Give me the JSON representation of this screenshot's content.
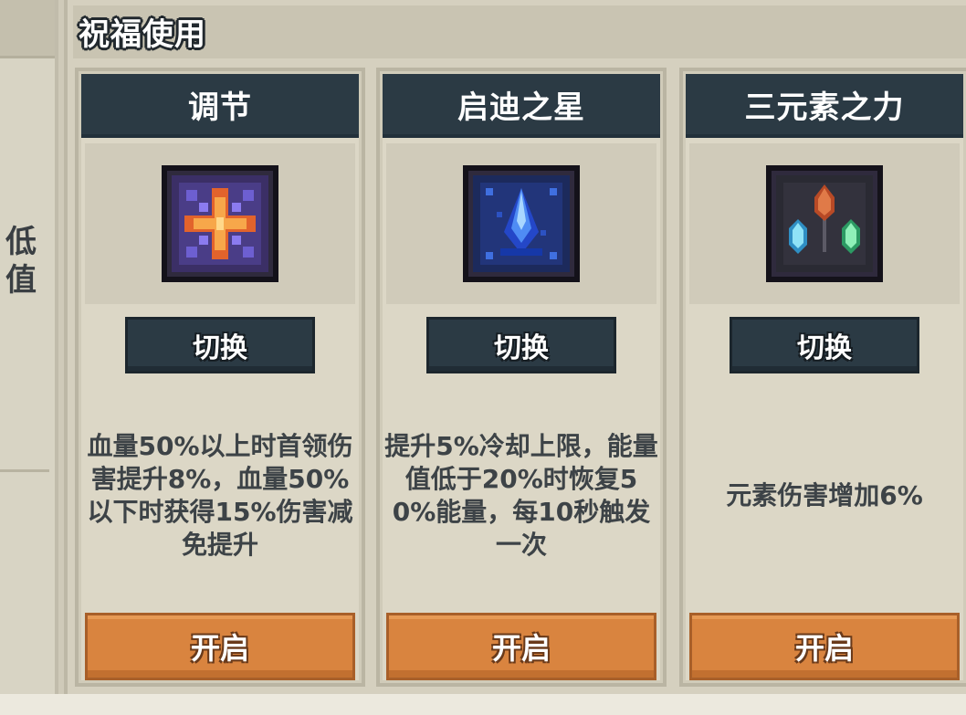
{
  "left_panel": {
    "text": "低\n值"
  },
  "section": {
    "title": "祝福使用"
  },
  "cards": [
    {
      "title": "调节",
      "icon": "cross-rune-icon",
      "switch_label": "切换",
      "description": "血量50%以上时首领伤害提升8%，血量50%以下时获得15%伤害减免提升",
      "open_label": "开启"
    },
    {
      "title": "启迪之星",
      "icon": "blue-crystal-icon",
      "switch_label": "切换",
      "description": "提升5%冷却上限，能量值低于20%时恢复50%能量，每10秒触发一次",
      "open_label": "开启"
    },
    {
      "title": "三元素之力",
      "icon": "three-gems-icon",
      "switch_label": "切换",
      "description": "元素伤害增加6%",
      "open_label": "开启"
    }
  ],
  "colors": {
    "card_header": "#2b3a44",
    "button_orange": "#d9843f",
    "panel_bg": "#d5d0bf"
  }
}
